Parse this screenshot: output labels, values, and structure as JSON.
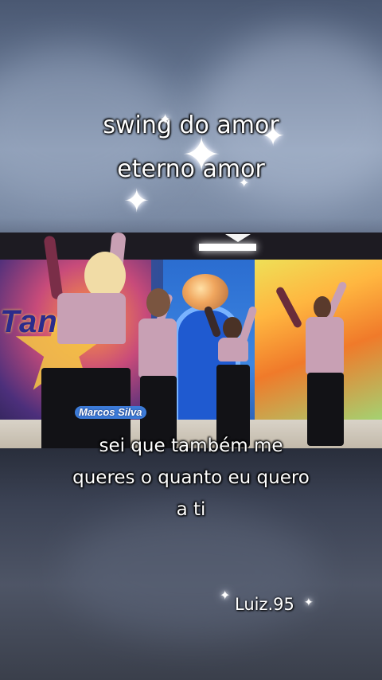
{
  "lyrics_top": {
    "line1": "swing do amor",
    "line2": "eterno amor"
  },
  "lyrics_bottom": {
    "line1": "sei que também me",
    "line2": "queres o quanto eu quero",
    "line3": "a ti"
  },
  "video": {
    "channel_badge": "Marcos Silva"
  },
  "watermark": {
    "handle": "Luiz.95"
  },
  "icons": [
    "sparkle-icon"
  ],
  "colors": {
    "caption_text": "#ffffff",
    "caption_outline": "#000000"
  }
}
